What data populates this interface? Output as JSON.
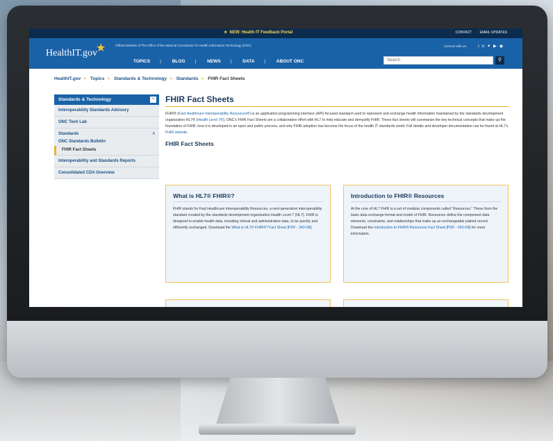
{
  "site": {
    "notice": "NEW: Health IT Feedback Portal",
    "contact": "CONTACT",
    "email_updates": "EMAIL UPDATES",
    "logo": "HealthIT.gov",
    "official": "Official Website of The Office of the National Coordinator for Health Information Technology (ONC)",
    "connect": "Connect with us:",
    "social": "in ▼ ⬤ И",
    "search_placeholder": "Search"
  },
  "nav": [
    "TOPICS",
    "BLOG",
    "NEWS",
    "DATA",
    "ABOUT ONC"
  ],
  "breadcrumb": [
    "HealthIT.gov",
    "Topics",
    "Standards & Technology",
    "Standards",
    "FHIR Fact Sheets"
  ],
  "sidebar": {
    "heading": "Standards & Technology",
    "toggle": "−",
    "items": [
      "Interoperability Standards Advisory",
      "ONC Tech Lab",
      "Standards",
      "ONC Standards Bulletin",
      "FHIR Fact Sheets",
      "Interoperability and Standards Reports",
      "Consolidated CDA Overview"
    ],
    "caret": "˄"
  },
  "main": {
    "title": "FHIR Fact Sheets",
    "intro_a": "FHIR® (",
    "intro_link1": "Fast Healthcare Interoperability Resources®",
    "intro_b": ") is an application programming interface (API)-focused standard used to represent and exchange health information maintained by the standards development organization HL7® (",
    "intro_link2": "Health Level 7®",
    "intro_c": "). ONC’s FHIR Fact Sheets are a collaborative effort with HL7 to help educate and demystify FHIR. These fact sheets will summarize the key technical concepts that make up the foundation of FHIR, how it is developed in an open and public process, and why FHIR adoption has become the focus of the health IT standards world. Full details and developer documentation can be found at HL7’s ",
    "intro_link3": "FHIR website",
    "intro_d": ".",
    "subhead": "FHIR Fact Sheets",
    "cards": [
      {
        "title": "What is HL7® FHIR®?",
        "body": "FHIR stands for Fast Healthcare Interoperability Resources, a next-generation interoperability standard created by the standards development organization Health Level 7 (HL7). FHIR is designed to enable health data, including clinical and administrative data, to be quickly and efficiently exchanged. Download the ",
        "link": "What is HL7® FHIR®? Fact Sheet [PDF - 343 KB]",
        "tail": "."
      },
      {
        "title": "Introduction to FHIR® Resources",
        "body": "At the core of HL7 FHIR is a set of modular components called “Resources.” These form the basic data exchange format and model of FHIR. Resources define the component data elements, constraints, and relationships that make up an exchangeable patient record. Download the ",
        "link": "Introduction to FHIR® Resources Fact Sheet [PDF - 565 KB]",
        "tail": " for more information."
      }
    ]
  }
}
